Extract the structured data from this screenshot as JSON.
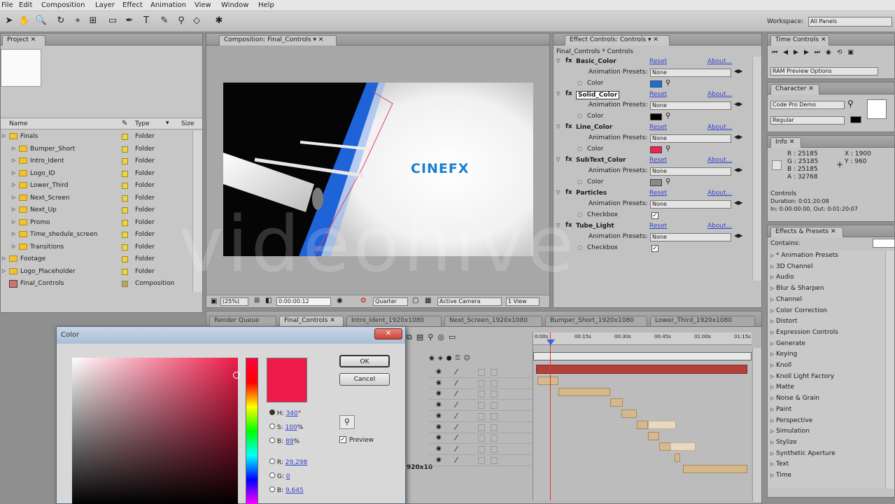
{
  "menu": [
    "File",
    "Edit",
    "Composition",
    "Layer",
    "Effect",
    "Animation",
    "View",
    "Window",
    "Help"
  ],
  "workspace": {
    "label": "Workspace:",
    "value": "All Panels"
  },
  "project": {
    "tab": "Project",
    "columns": [
      "Name",
      "Type",
      "Size"
    ],
    "items": [
      {
        "name": "Finals",
        "type": "Folder",
        "indent": 0,
        "kind": "folder"
      },
      {
        "name": "Bumper_Short",
        "type": "Folder",
        "indent": 1,
        "kind": "folder"
      },
      {
        "name": "Intro_Ident",
        "type": "Folder",
        "indent": 1,
        "kind": "folder"
      },
      {
        "name": "Logo_ID",
        "type": "Folder",
        "indent": 1,
        "kind": "folder"
      },
      {
        "name": "Lower_Third",
        "type": "Folder",
        "indent": 1,
        "kind": "folder"
      },
      {
        "name": "Next_Screen",
        "type": "Folder",
        "indent": 1,
        "kind": "folder"
      },
      {
        "name": "Next_Up",
        "type": "Folder",
        "indent": 1,
        "kind": "folder"
      },
      {
        "name": "Promo",
        "type": "Folder",
        "indent": 1,
        "kind": "folder"
      },
      {
        "name": "Time_shedule_screen",
        "type": "Folder",
        "indent": 1,
        "kind": "folder"
      },
      {
        "name": "Transitions",
        "type": "Folder",
        "indent": 1,
        "kind": "folder"
      },
      {
        "name": "Footage",
        "type": "Folder",
        "indent": 0,
        "kind": "folder"
      },
      {
        "name": "Logo_Placeholder",
        "type": "Folder",
        "indent": 0,
        "kind": "folder"
      },
      {
        "name": "Final_Controls",
        "type": "Composition",
        "indent": 0,
        "kind": "comp"
      }
    ]
  },
  "composition": {
    "tab": "Composition: Final_Controls",
    "logo": "CINEFX",
    "zoom": "(25%)",
    "timecode": "0:00:00:12",
    "resolution": "Quarter",
    "camera": "Active Camera",
    "views": "1 View"
  },
  "effect_controls": {
    "tab": "Effect Controls: Controls",
    "subtitle": "Final_Controls * Controls",
    "reset": "Reset",
    "about": "About...",
    "presets_label": "Animation Presets:",
    "presets_value": "None",
    "effects": [
      {
        "name": "Basic_Color",
        "prop": "Color",
        "kind": "color",
        "color": "#1a6ee0"
      },
      {
        "name": "Solid_Color",
        "prop": "Color",
        "kind": "color",
        "color": "#000000"
      },
      {
        "name": "Line_Color",
        "prop": "Color",
        "kind": "color",
        "color": "#ee2255"
      },
      {
        "name": "SubText_Color",
        "prop": "Color",
        "kind": "color",
        "color": "#8a8a8a"
      },
      {
        "name": "Particles",
        "prop": "Checkbox",
        "kind": "checkbox"
      },
      {
        "name": "Tube_Light",
        "prop": "Checkbox",
        "kind": "checkbox"
      }
    ]
  },
  "time_controls": {
    "tab": "Time Controls",
    "ram_preview": "RAM Preview Options"
  },
  "character": {
    "tab": "Character",
    "font": "Code Pro Demo",
    "style": "Regular"
  },
  "info": {
    "tab": "Info",
    "r": "R : 25185",
    "g": "G : 25185",
    "b": "B : 25185",
    "a": "A : 32768",
    "x": "X : 1900",
    "y": "Y : 960",
    "comp": "Controls",
    "duration": "Duration: 0:01:20:08",
    "inout": "In: 0:00:00:00, Out: 0:01:20:07"
  },
  "effects_presets": {
    "tab": "Effects & Presets",
    "contains": "Contains:",
    "items": [
      "* Animation Presets",
      "3D Channel",
      "Audio",
      "Blur & Sharpen",
      "Channel",
      "Color Correction",
      "Distort",
      "Expression Controls",
      "Generate",
      "Keying",
      "Knoll",
      "Knoll Light Factory",
      "Matte",
      "Noise & Grain",
      "Paint",
      "Perspective",
      "Simulation",
      "Stylize",
      "Synthetic Aperture",
      "Text",
      "Time"
    ]
  },
  "timeline": {
    "tabs": [
      "Render Queue",
      "Final_Controls",
      "Intro_Ident_1920x1080",
      "Next_Screen_1920x1080",
      "Bumper_Short_1920x1080",
      "Lower_Third_1920x1080"
    ],
    "ruler": [
      "0:00s",
      "00:15s",
      "00:30s",
      "00:45s",
      "01:00s",
      "01:15s"
    ],
    "layer_label": "920x10"
  },
  "color_dialog": {
    "title": "Color",
    "ok": "OK",
    "cancel": "Cancel",
    "h_label": "H:",
    "h_value": "340",
    "h_unit": "°",
    "s_label": "S:",
    "s_value": "100",
    "s_unit": "%",
    "b_label": "B:",
    "b_value": "89",
    "b_unit": "%",
    "r_label": "R:",
    "r_value": "29,298",
    "g_label": "G:",
    "g_value": "0",
    "bl_label": "B:",
    "bl_value": "9,645",
    "preview": "Preview",
    "selected_color": "#ee1a48"
  },
  "watermark": "videohive"
}
